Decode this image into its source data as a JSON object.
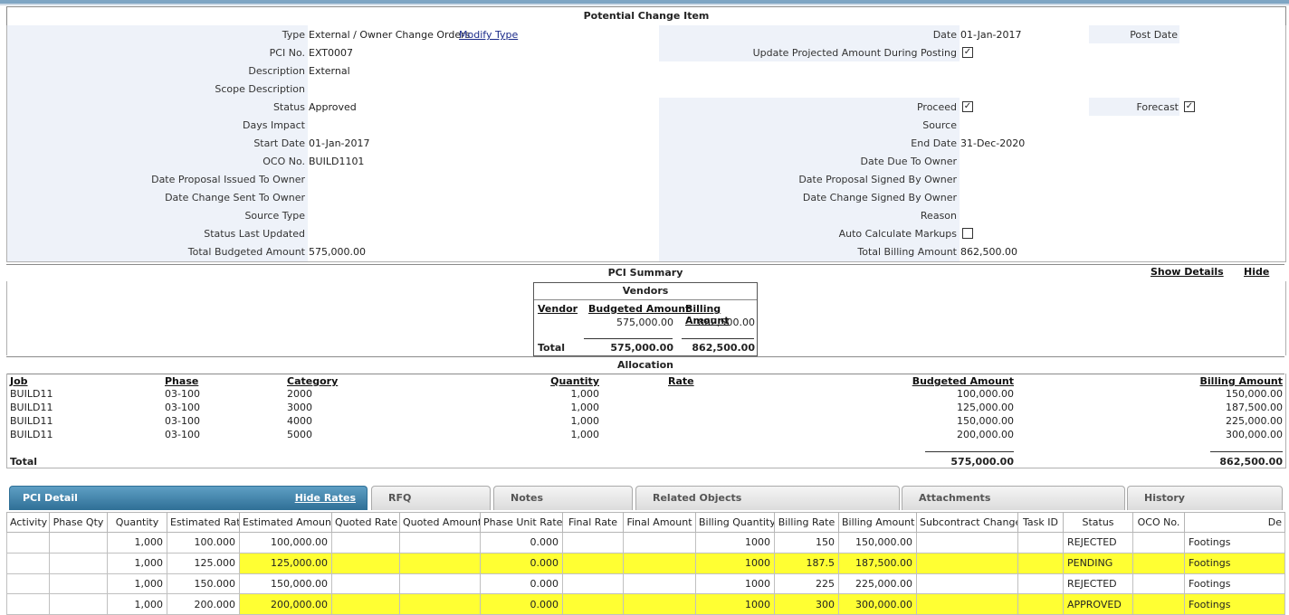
{
  "header": {
    "title": "Potential Change Item"
  },
  "form": {
    "type_label": "Type",
    "type_value": "External / Owner Change Orders",
    "modify_type_link": "Modify Type",
    "pci_no_label": "PCI No.",
    "pci_no_value": "EXT0007",
    "description_label": "Description",
    "description_value": "External",
    "scope_description_label": "Scope Description",
    "scope_description_value": "",
    "status_label": "Status",
    "status_value": "Approved",
    "days_impact_label": "Days Impact",
    "days_impact_value": "",
    "start_date_label": "Start Date",
    "start_date_value": "01-Jan-2017",
    "oco_no_label": "OCO No.",
    "oco_no_value": "BUILD1101",
    "date_proposal_issued_label": "Date Proposal Issued To Owner",
    "date_change_sent_label": "Date Change Sent To Owner",
    "source_type_label": "Source Type",
    "status_last_updated_label": "Status Last Updated",
    "total_budgeted_label": "Total Budgeted Amount",
    "total_budgeted_value": "575,000.00",
    "date_label": "Date",
    "date_value": "01-Jan-2017",
    "post_date_label": "Post Date",
    "update_projected_label": "Update Projected Amount During Posting",
    "update_projected_checked": true,
    "proceed_label": "Proceed",
    "proceed_checked": true,
    "forecast_label": "Forecast",
    "forecast_checked": true,
    "source_label": "Source",
    "end_date_label": "End Date",
    "end_date_value": "31-Dec-2020",
    "date_due_label": "Date Due To Owner",
    "date_proposal_signed_label": "Date Proposal Signed By Owner",
    "date_change_signed_label": "Date Change Signed By Owner",
    "reason_label": "Reason",
    "auto_calc_label": "Auto Calculate Markups",
    "auto_calc_checked": false,
    "total_billing_label": "Total Billing Amount",
    "total_billing_value": "862,500.00"
  },
  "summary": {
    "title": "PCI Summary",
    "show_details": "Show Details",
    "hide": "Hide",
    "vendors": {
      "title": "Vendors",
      "col_vendor": "Vendor",
      "col_budgeted": "Budgeted Amount",
      "col_billing": "Billing Amount",
      "row_budgeted": "575,000.00",
      "row_billing": "862,500.00",
      "total_label": "Total",
      "total_budgeted": "575,000.00",
      "total_billing": "862,500.00"
    }
  },
  "allocation": {
    "title": "Allocation",
    "headers": {
      "job": "Job",
      "phase": "Phase",
      "category": "Category",
      "quantity": "Quantity",
      "rate": "Rate",
      "budgeted": "Budgeted Amount",
      "billing": "Billing Amount"
    },
    "rows": [
      {
        "job": "BUILD11",
        "phase": "03-100",
        "category": "2000",
        "quantity": "1,000",
        "budgeted": "100,000.00",
        "billing": "150,000.00"
      },
      {
        "job": "BUILD11",
        "phase": "03-100",
        "category": "3000",
        "quantity": "1,000",
        "budgeted": "125,000.00",
        "billing": "187,500.00"
      },
      {
        "job": "BUILD11",
        "phase": "03-100",
        "category": "4000",
        "quantity": "1,000",
        "budgeted": "150,000.00",
        "billing": "225,000.00"
      },
      {
        "job": "BUILD11",
        "phase": "03-100",
        "category": "5000",
        "quantity": "1,000",
        "budgeted": "200,000.00",
        "billing": "300,000.00"
      }
    ],
    "total_label": "Total",
    "total_budgeted": "575,000.00",
    "total_billing": "862,500.00"
  },
  "tabs": {
    "pci_detail": "PCI Detail",
    "hide_rates": "Hide Rates",
    "rfq": "RFQ",
    "notes": "Notes",
    "related": "Related Objects",
    "attachments": "Attachments",
    "history": "History"
  },
  "detail": {
    "columns": [
      "Activity",
      "Phase Qty",
      "Quantity",
      "Estimated Rate",
      "Estimated Amount",
      "Quoted Rate",
      "Quoted Amount",
      "Phase Unit Rate",
      "Final Rate",
      "Final Amount",
      "Billing Quantity",
      "Billing Rate",
      "Billing Amount",
      "Subcontract Change",
      "Task ID",
      "Status",
      "OCO No.",
      "De"
    ],
    "rows": [
      {
        "quantity": "1,000",
        "est_rate": "100.000",
        "est_amount": "100,000.00",
        "phase_unit_rate": "0.000",
        "billing_qty": "1000",
        "billing_rate": "150",
        "billing_amount": "150,000.00",
        "status": "REJECTED",
        "desc": "Footings",
        "highlight": false
      },
      {
        "quantity": "1,000",
        "est_rate": "125.000",
        "est_amount": "125,000.00",
        "phase_unit_rate": "0.000",
        "billing_qty": "1000",
        "billing_rate": "187.5",
        "billing_amount": "187,500.00",
        "status": "PENDING",
        "desc": "Footings",
        "highlight": true
      },
      {
        "quantity": "1,000",
        "est_rate": "150.000",
        "est_amount": "150,000.00",
        "phase_unit_rate": "0.000",
        "billing_qty": "1000",
        "billing_rate": "225",
        "billing_amount": "225,000.00",
        "status": "REJECTED",
        "desc": "Footings",
        "highlight": false
      },
      {
        "quantity": "1,000",
        "est_rate": "200.000",
        "est_amount": "200,000.00",
        "phase_unit_rate": "0.000",
        "billing_qty": "1000",
        "billing_rate": "300",
        "billing_amount": "300,000.00",
        "status": "APPROVED",
        "desc": "Footings",
        "highlight": true
      }
    ]
  }
}
